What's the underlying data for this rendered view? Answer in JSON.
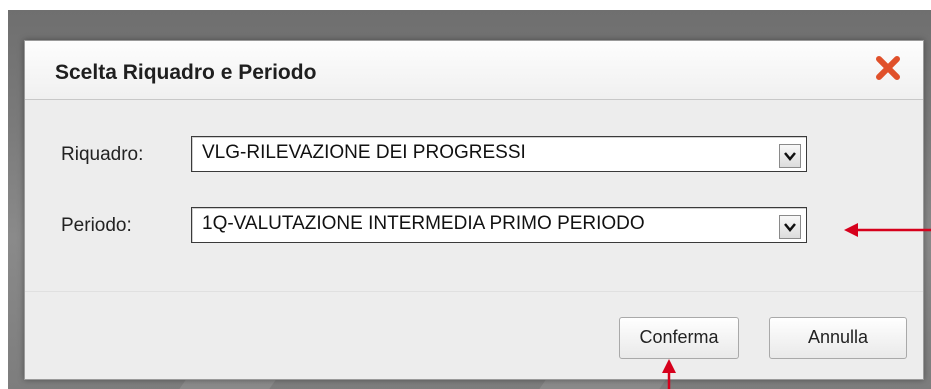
{
  "dialog": {
    "title": "Scelta Riquadro e Periodo",
    "close_icon": "close-icon",
    "accent_close_color": "#e0502a"
  },
  "form": {
    "riquadro": {
      "label": "Riquadro:",
      "value": "VLG-RILEVAZIONE DEI PROGRESSI"
    },
    "periodo": {
      "label": "Periodo:",
      "value": "1Q-VALUTAZIONE INTERMEDIA PRIMO PERIODO"
    }
  },
  "buttons": {
    "confirm_label": "Conferma",
    "cancel_label": "Annulla"
  },
  "annotations": {
    "arrow_color": "#d6001c",
    "items": [
      "annotation-arrow-periodo",
      "annotation-arrow-conferma"
    ]
  }
}
